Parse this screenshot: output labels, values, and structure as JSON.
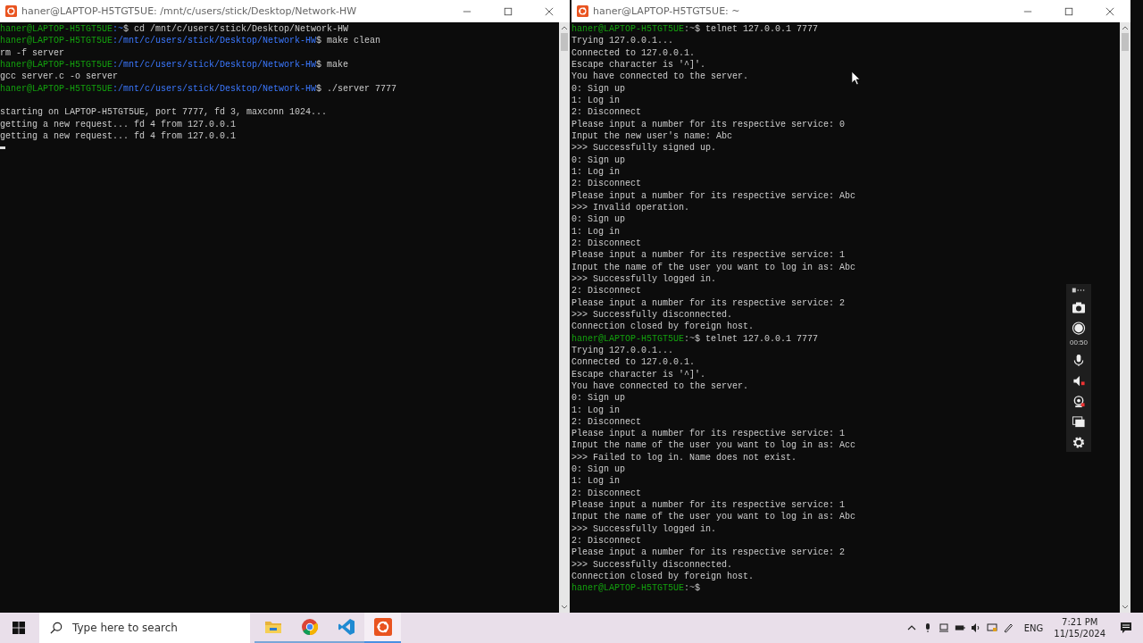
{
  "windows": [
    {
      "title": "haner@LAPTOP-H5TGT5UE: /mnt/c/users/stick/Desktop/Network-HW",
      "cursor": true,
      "lines": [
        {
          "kind": "prompt",
          "user": "haner@LAPTOP-H5TGT5UE",
          "path": ":~",
          "command": "$ cd /mnt/c/users/stick/Desktop/Network-HW"
        },
        {
          "kind": "prompt",
          "user": "haner@LAPTOP-H5TGT5UE",
          "path": ":/mnt/c/users/stick/Desktop/Network-HW",
          "command": "$ make clean"
        },
        {
          "kind": "output",
          "text": "rm -f server"
        },
        {
          "kind": "prompt",
          "user": "haner@LAPTOP-H5TGT5UE",
          "path": ":/mnt/c/users/stick/Desktop/Network-HW",
          "command": "$ make"
        },
        {
          "kind": "output",
          "text": "gcc server.c -o server"
        },
        {
          "kind": "prompt",
          "user": "haner@LAPTOP-H5TGT5UE",
          "path": ":/mnt/c/users/stick/Desktop/Network-HW",
          "command": "$ ./server 7777"
        },
        {
          "kind": "blank"
        },
        {
          "kind": "output",
          "text": "starting on LAPTOP-H5TGT5UE, port 7777, fd 3, maxconn 1024..."
        },
        {
          "kind": "output",
          "text": "getting a new request... fd 4 from 127.0.0.1"
        },
        {
          "kind": "output",
          "text": "getting a new request... fd 4 from 127.0.0.1"
        }
      ]
    },
    {
      "title": "haner@LAPTOP-H5TGT5UE: ~",
      "lines": [
        {
          "kind": "prompt",
          "user": "haner@LAPTOP-H5TGT5UE",
          "path": ":~",
          "command": "$ telnet 127.0.0.1 7777"
        },
        {
          "kind": "output",
          "text": "Trying 127.0.0.1..."
        },
        {
          "kind": "output",
          "text": "Connected to 127.0.0.1."
        },
        {
          "kind": "output",
          "text": "Escape character is '^]'."
        },
        {
          "kind": "output",
          "text": "You have connected to the server."
        },
        {
          "kind": "output",
          "text": "0: Sign up"
        },
        {
          "kind": "output",
          "text": "1: Log in"
        },
        {
          "kind": "output",
          "text": "2: Disconnect"
        },
        {
          "kind": "output",
          "text": "Please input a number for its respective service: 0"
        },
        {
          "kind": "output",
          "text": "Input the new user's name: Abc"
        },
        {
          "kind": "output",
          "text": ">>> Successfully signed up."
        },
        {
          "kind": "output",
          "text": "0: Sign up"
        },
        {
          "kind": "output",
          "text": "1: Log in"
        },
        {
          "kind": "output",
          "text": "2: Disconnect"
        },
        {
          "kind": "output",
          "text": "Please input a number for its respective service: Abc"
        },
        {
          "kind": "output",
          "text": ">>> Invalid operation."
        },
        {
          "kind": "output",
          "text": "0: Sign up"
        },
        {
          "kind": "output",
          "text": "1: Log in"
        },
        {
          "kind": "output",
          "text": "2: Disconnect"
        },
        {
          "kind": "output",
          "text": "Please input a number for its respective service: 1"
        },
        {
          "kind": "output",
          "text": "Input the name of the user you want to log in as: Abc"
        },
        {
          "kind": "output",
          "text": ">>> Successfully logged in."
        },
        {
          "kind": "output",
          "text": "2: Disconnect"
        },
        {
          "kind": "output",
          "text": "Please input a number for its respective service: 2"
        },
        {
          "kind": "output",
          "text": ">>> Successfully disconnected."
        },
        {
          "kind": "output",
          "text": "Connection closed by foreign host."
        },
        {
          "kind": "prompt",
          "user": "haner@LAPTOP-H5TGT5UE",
          "path": ":~",
          "command": "$ telnet 127.0.0.1 7777"
        },
        {
          "kind": "output",
          "text": "Trying 127.0.0.1..."
        },
        {
          "kind": "output",
          "text": "Connected to 127.0.0.1."
        },
        {
          "kind": "output",
          "text": "Escape character is '^]'."
        },
        {
          "kind": "output",
          "text": "You have connected to the server."
        },
        {
          "kind": "output",
          "text": "0: Sign up"
        },
        {
          "kind": "output",
          "text": "1: Log in"
        },
        {
          "kind": "output",
          "text": "2: Disconnect"
        },
        {
          "kind": "output",
          "text": "Please input a number for its respective service: 1"
        },
        {
          "kind": "output",
          "text": "Input the name of the user you want to log in as: Acc"
        },
        {
          "kind": "output",
          "text": ">>> Failed to log in. Name does not exist."
        },
        {
          "kind": "output",
          "text": "0: Sign up"
        },
        {
          "kind": "output",
          "text": "1: Log in"
        },
        {
          "kind": "output",
          "text": "2: Disconnect"
        },
        {
          "kind": "output",
          "text": "Please input a number for its respective service: 1"
        },
        {
          "kind": "output",
          "text": "Input the name of the user you want to log in as: Abc"
        },
        {
          "kind": "output",
          "text": ">>> Successfully logged in."
        },
        {
          "kind": "output",
          "text": "2: Disconnect"
        },
        {
          "kind": "output",
          "text": "Please input a number for its respective service: 2"
        },
        {
          "kind": "output",
          "text": ">>> Successfully disconnected."
        },
        {
          "kind": "output",
          "text": "Connection closed by foreign host."
        },
        {
          "kind": "prompt",
          "user": "haner@LAPTOP-H5TGT5UE",
          "path": ":~",
          "command": "$"
        }
      ]
    }
  ],
  "recorder": {
    "timer": "00:50"
  },
  "taskbar": {
    "search": {
      "placeholder": "Type here to search"
    },
    "apps": [
      {
        "kind": "explorer",
        "selected": false
      },
      {
        "kind": "chrome",
        "selected": false
      },
      {
        "kind": "vscode",
        "selected": false
      },
      {
        "kind": "ubuntu",
        "selected": true
      }
    ],
    "tray": {
      "language": "ENG",
      "time": "7:21 PM",
      "date": "11/15/2024"
    }
  }
}
